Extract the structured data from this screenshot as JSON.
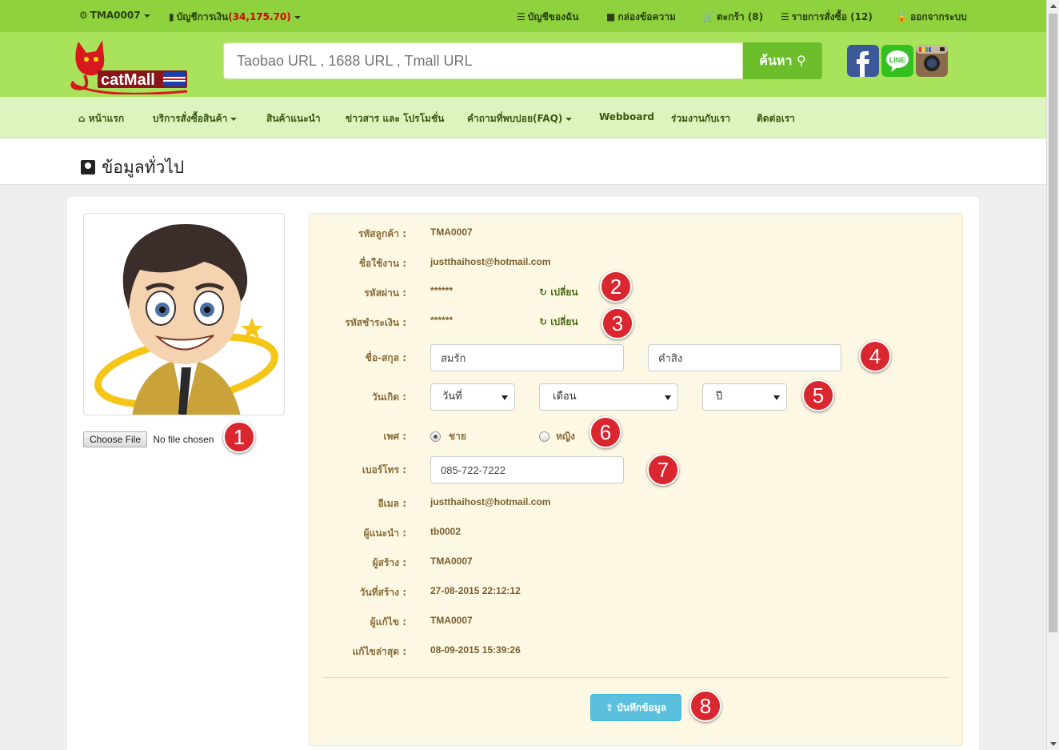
{
  "topbar": {
    "user": "TMA0007",
    "account_label": "บัญชีการเงิน",
    "account_balance": "(34,175.70)",
    "my_account": "บัญชีของฉัน",
    "inbox": "กล่องข้อความ",
    "cart": "ตะกร้า (8)",
    "orders": "รายการสั่งซื้อ (12)",
    "logout": "ออกจากระบบ"
  },
  "header": {
    "logo_text": "catMall",
    "search_placeholder": "Taobao URL , 1688 URL , Tmall URL",
    "search_button": "ค้นหา",
    "social": [
      "facebook-icon",
      "line-icon",
      "instagram-icon"
    ],
    "social_line_text": "LINE"
  },
  "nav": {
    "home": "หน้าแรก",
    "services": "บริการสั่งซื้อสินค้า",
    "recommended": "สินค้าแนะนำ",
    "news": "ข่าวสาร และ โปรโมชั่น",
    "faq": "คำถามที่พบบ่อย(FAQ)",
    "webboard": "Webboard",
    "partner": "ร่วมงานกับเรา",
    "contact": "ติดต่อเรา"
  },
  "page": {
    "title": "ข้อมูลทั่วไป"
  },
  "upload": {
    "button": "Choose File",
    "status": "No file chosen"
  },
  "form": {
    "customer_id": {
      "label": "รหัสลูกค้า :",
      "value": "TMA0007"
    },
    "username": {
      "label": "ชื่อใช้งาน :",
      "value": "justthaihost@hotmail.com"
    },
    "password": {
      "label": "รหัสผ่าน :",
      "value": "******",
      "change": "เปลี่ยน"
    },
    "payment_password": {
      "label": "รหัสชำระเงิน :",
      "value": "******",
      "change": "เปลี่ยน"
    },
    "fullname": {
      "label": "ชื่อ-สกุล :",
      "first": "สมรัก",
      "last": "คำสิง"
    },
    "birthday": {
      "label": "วันเกิด :",
      "day": "วันที่",
      "month": "เดือน",
      "year": "ปี"
    },
    "gender": {
      "label": "เพศ :",
      "male": "ชาย",
      "female": "หญิง",
      "selected": "male"
    },
    "phone": {
      "label": "เบอร์โทร :",
      "value": "085-722-7222"
    },
    "email": {
      "label": "อีเมล :",
      "value": "justthaihost@hotmail.com"
    },
    "referrer": {
      "label": "ผู้แนะนำ :",
      "value": "tb0002"
    },
    "creator": {
      "label": "ผู้สร้าง :",
      "value": "TMA0007"
    },
    "created_at": {
      "label": "วันที่สร้าง :",
      "value": "27-08-2015 22:12:12"
    },
    "editor": {
      "label": "ผู้แก้ไข :",
      "value": "TMA0007"
    },
    "updated_at": {
      "label": "แก้ไขล่าสุด :",
      "value": "08-09-2015 15:39:26"
    },
    "save_button": "บันทึกข้อมูล"
  },
  "badges": [
    "1",
    "2",
    "3",
    "4",
    "5",
    "6",
    "7",
    "8"
  ],
  "colors": {
    "topbar": "#8ed33e",
    "header": "#a9e35b",
    "nav": "#dcf4bd",
    "form_bg": "#fcf8e3",
    "badge": "#d9262f",
    "save": "#5bc0de"
  }
}
